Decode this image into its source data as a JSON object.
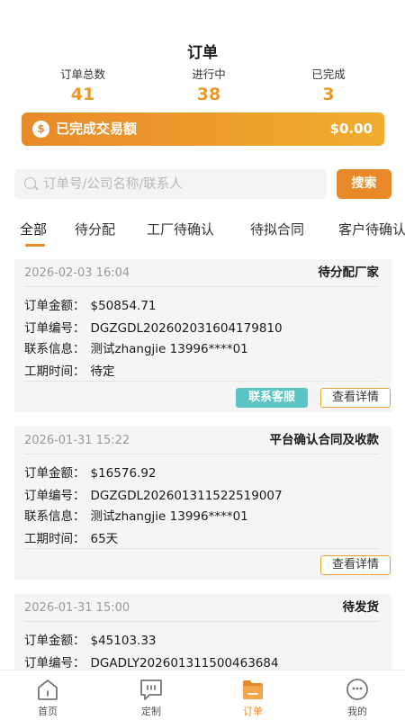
{
  "header": {
    "title": "订单"
  },
  "stats": [
    {
      "label": "订单总数",
      "value": "41"
    },
    {
      "label": "进行中",
      "value": "38"
    },
    {
      "label": "已完成",
      "value": "3"
    }
  ],
  "banner": {
    "icon": "money-bag-icon",
    "label": "已完成交易额",
    "amount": "$0.00"
  },
  "search": {
    "placeholder": "订单号/公司名称/联系人",
    "value": "",
    "button_label": "搜索"
  },
  "tabs": [
    {
      "label": "全部",
      "active": true
    },
    {
      "label": "待分配",
      "active": false
    },
    {
      "label": "工厂待确认",
      "active": false
    },
    {
      "label": "待拟合同",
      "active": false
    },
    {
      "label": "客户待确认",
      "active": false
    }
  ],
  "field_labels": {
    "amount": "订单金额：",
    "number": "订单编号：",
    "contact": "联系信息：",
    "period": "工期时间："
  },
  "orders": [
    {
      "time": "2026-02-03 16:04",
      "status": "待分配厂家",
      "amount": "$50854.71",
      "number": "DGZGDL202602031604179810",
      "contact": "测试zhangjie 13996****01",
      "period": "待定",
      "btn_service": "联系客服",
      "btn_detail": "查看详情"
    },
    {
      "time": "2026-01-31 15:22",
      "status": "平台确认合同及收款",
      "amount": "$16576.92",
      "number": "DGZGDL202601311522519007",
      "contact": "测试zhangjie 13996****01",
      "period": "65天",
      "btn_detail": "查看详情"
    },
    {
      "time": "2026-01-31 15:00",
      "status": "待发货",
      "amount": "$45103.33",
      "number": "DGADLY202601311500463684"
    }
  ],
  "tabbar": [
    {
      "label": "首页",
      "icon": "home-icon",
      "active": false
    },
    {
      "label": "定制",
      "icon": "chat-icon",
      "active": false
    },
    {
      "label": "订单",
      "icon": "folder-icon",
      "active": true
    },
    {
      "label": "我的",
      "icon": "profile-icon",
      "active": false
    }
  ],
  "colors": {
    "accent": "#e8892a",
    "stat_number": "#e89a2c",
    "service_button": "#5bc4c4"
  }
}
